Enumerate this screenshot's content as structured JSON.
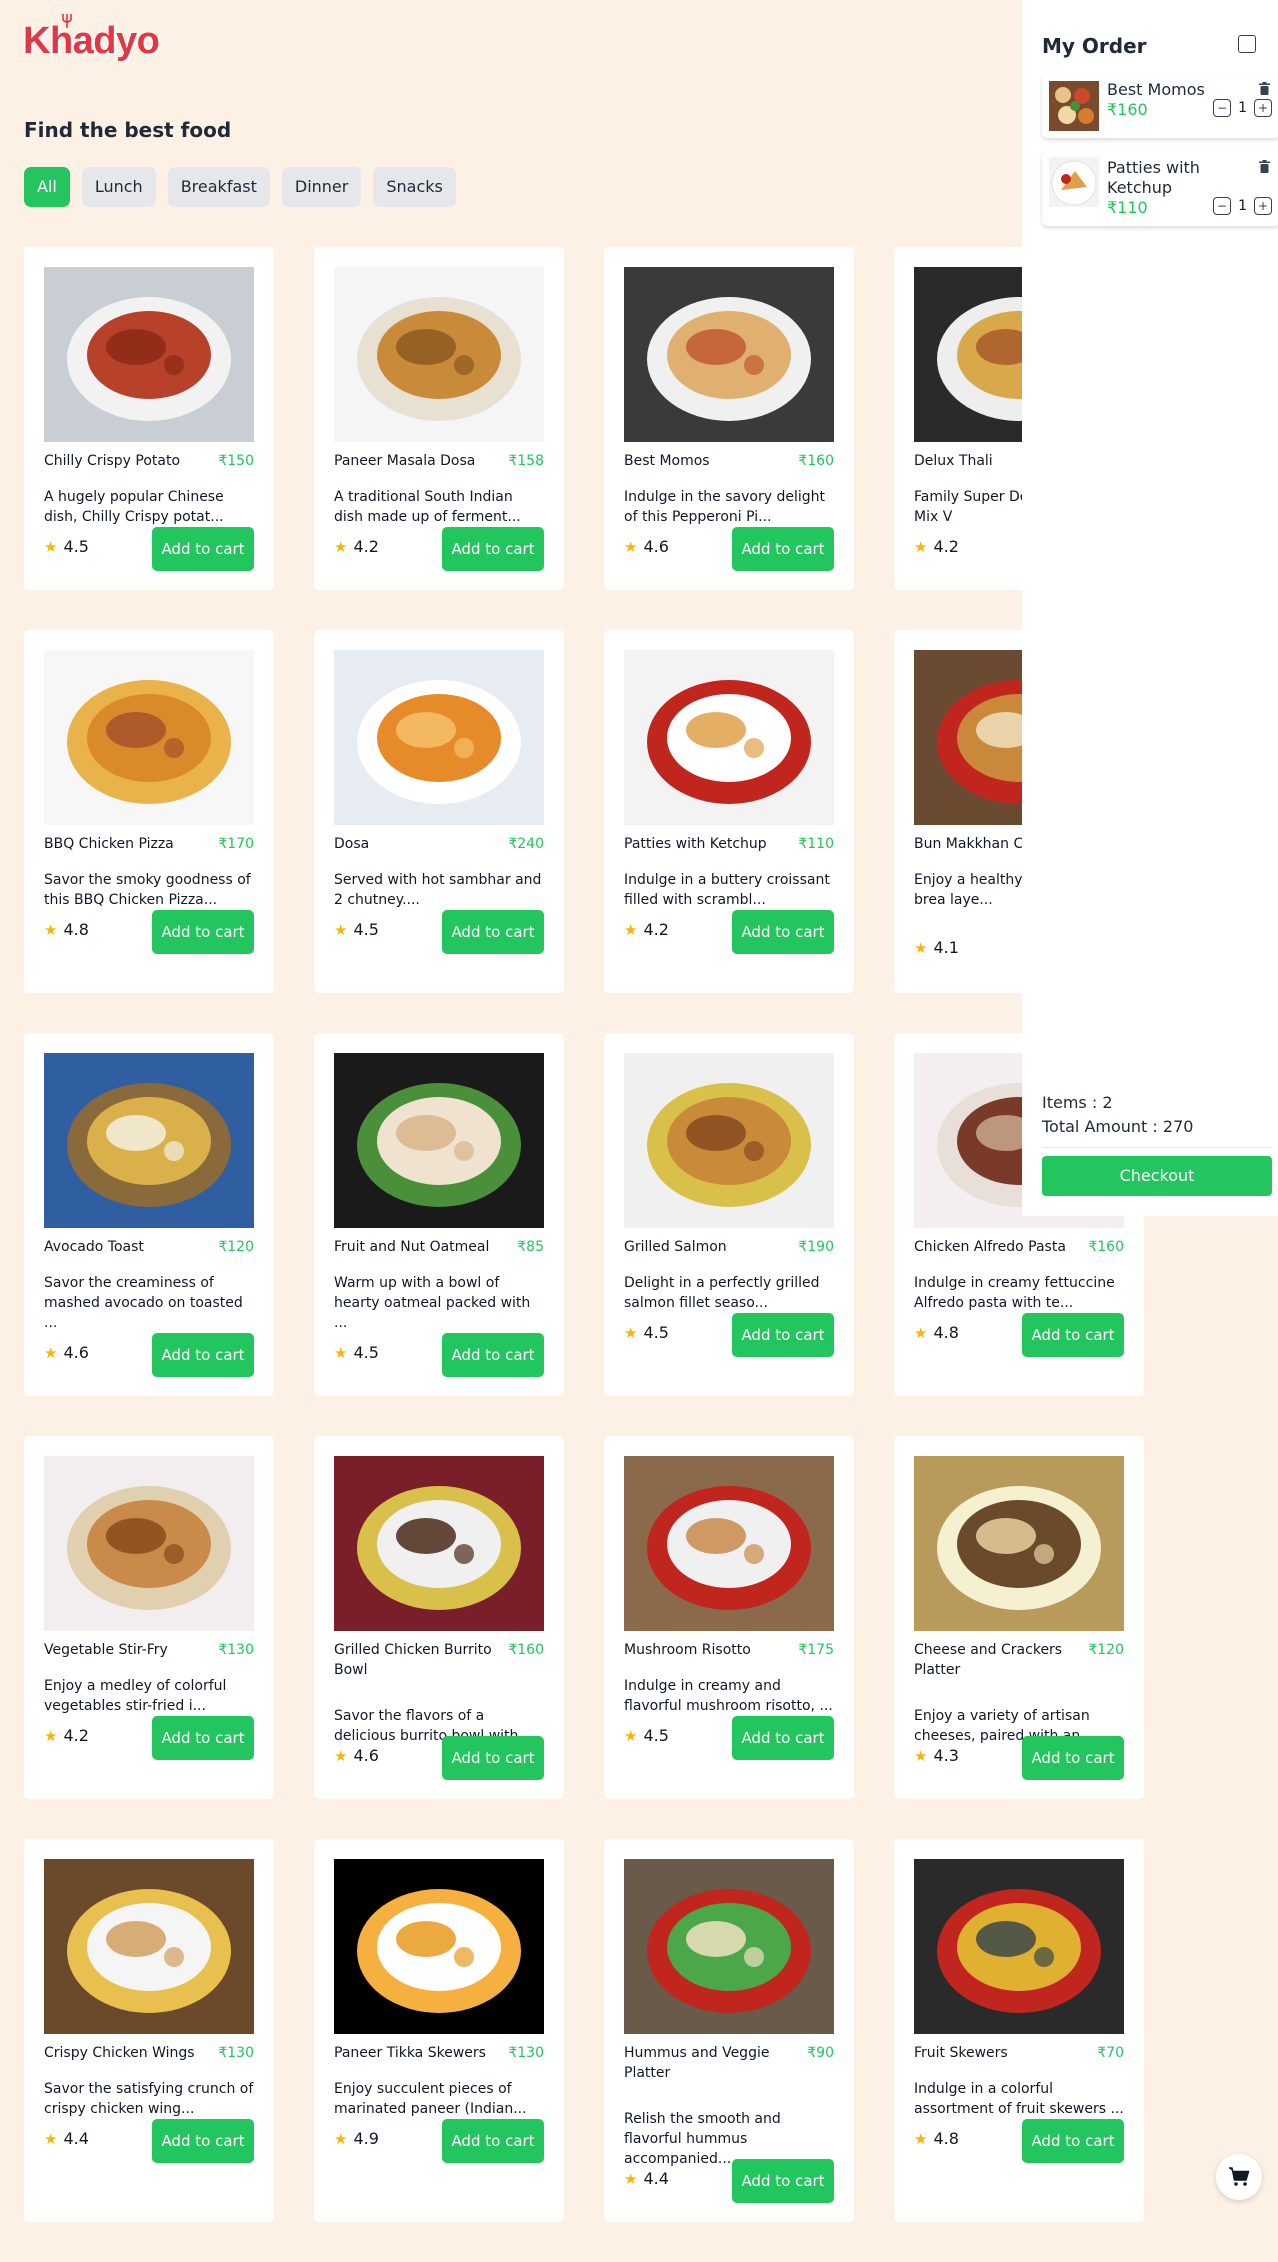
{
  "brand": {
    "name": "Khadyo"
  },
  "main": {
    "heading": "Find the best food",
    "tabs": [
      {
        "label": "All",
        "active": true
      },
      {
        "label": "Lunch"
      },
      {
        "label": "Breakfast"
      },
      {
        "label": "Dinner"
      },
      {
        "label": "Snacks"
      }
    ],
    "add_label": "Add to cart",
    "products": [
      {
        "name": "Chilly Crispy Potato",
        "price": "₹150",
        "desc": "A hugely popular Chinese dish, Chilly Crispy potat...",
        "rating": "4.5"
      },
      {
        "name": "Paneer Masala Dosa",
        "price": "₹158",
        "desc": "A traditional South Indian dish made up of ferment...",
        "rating": "4.2"
      },
      {
        "name": "Best Momos",
        "price": "₹160",
        "desc": "Indulge in the savory delight of this Pepperoni Pi...",
        "rating": "4.6"
      },
      {
        "name": "Delux Thali",
        "price": "",
        "desc": "Family Super Del Makhani + Mix V",
        "rating": "4.2"
      },
      {
        "name": "BBQ Chicken Pizza",
        "price": "₹170",
        "desc": "Savor the smoky goodness of this BBQ Chicken Pizza...",
        "rating": "4.8"
      },
      {
        "name": "Dosa",
        "price": "₹240",
        "desc": "Served with hot sambhar and 2 chutney....",
        "rating": "4.5"
      },
      {
        "name": "Patties with Ketchup",
        "price": "₹110",
        "desc": "Indulge in a buttery croissant filled with scrambl...",
        "rating": "4.2"
      },
      {
        "name": "Bun Makkhan C",
        "price": "",
        "desc": "Enjoy a healthy refreshing brea laye...",
        "rating": "4.1"
      },
      {
        "name": "Avocado Toast",
        "price": "₹120",
        "desc": "Savor the creaminess of mashed avocado on toasted ...",
        "rating": "4.6"
      },
      {
        "name": "Fruit and Nut Oatmeal",
        "price": "₹85",
        "desc": "Warm up with a bowl of hearty oatmeal packed with ...",
        "rating": "4.5"
      },
      {
        "name": "Grilled Salmon",
        "price": "₹190",
        "desc": "Delight in a perfectly grilled salmon fillet seaso...",
        "rating": "4.5"
      },
      {
        "name": "Chicken Alfredo Pasta",
        "price": "₹160",
        "desc": "Indulge in creamy fettuccine Alfredo pasta with te...",
        "rating": "4.8"
      },
      {
        "name": "Vegetable Stir-Fry",
        "price": "₹130",
        "desc": "Enjoy a medley of colorful vegetables stir-fried i...",
        "rating": "4.2"
      },
      {
        "name": "Grilled Chicken Burrito Bowl",
        "price": "₹160",
        "desc": "Savor the flavors of a delicious burrito bowl with...",
        "rating": "4.6"
      },
      {
        "name": "Mushroom Risotto",
        "price": "₹175",
        "desc": "Indulge in creamy and flavorful mushroom risotto, ...",
        "rating": "4.5"
      },
      {
        "name": "Cheese and Crackers Platter",
        "price": "₹120",
        "desc": "Enjoy a variety of artisan cheeses, paired with an...",
        "rating": "4.3"
      },
      {
        "name": "Crispy Chicken Wings",
        "price": "₹130",
        "desc": "Savor the satisfying crunch of crispy chicken wing...",
        "rating": "4.4"
      },
      {
        "name": "Paneer Tikka Skewers",
        "price": "₹130",
        "desc": "Enjoy succulent pieces of marinated paneer (Indian...",
        "rating": "4.9"
      },
      {
        "name": "Hummus and Veggie Platter",
        "price": "₹90",
        "desc": "Relish the smooth and flavorful hummus accompanied...",
        "rating": "4.4"
      },
      {
        "name": "Fruit Skewers",
        "price": "₹70",
        "desc": "Indulge in a colorful assortment of fruit skewers ...",
        "rating": "4.8"
      }
    ]
  },
  "order": {
    "title": "My Order",
    "items": [
      {
        "name": "Best Momos",
        "price": "₹160",
        "qty": "1"
      },
      {
        "name": "Patties with Ketchup",
        "price": "₹110",
        "qty": "1"
      }
    ],
    "items_label": "Items : 2",
    "total_label": "Total Amount : 270",
    "checkout_label": "Checkout"
  },
  "colors": {
    "accent": "#22c55e",
    "brand": "#e23744",
    "background": "#fdf1e6",
    "star": "#f5b50a"
  },
  "icons": {
    "cart": "cart-icon",
    "star": "star-icon",
    "trash": "trash-icon",
    "close": "close-icon"
  }
}
